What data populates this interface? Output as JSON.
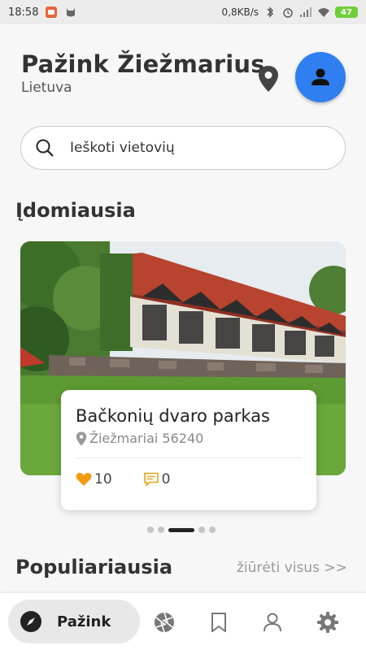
{
  "status_bar": {
    "time": "18:58",
    "speed": "0,8KB/s",
    "battery": "47"
  },
  "header": {
    "title": "Pažink Žiežmarius",
    "subtitle": "Lietuva"
  },
  "search": {
    "placeholder": "Ieškoti vietovių"
  },
  "featured": {
    "section_title": "Įdomiausia",
    "place_name": "Bačkonių dvaro parkas",
    "address": "Žiežmariai 56240",
    "likes": "10",
    "comments": "0",
    "carousel_active_index": 2,
    "carousel_count": 5
  },
  "popular": {
    "section_title": "Populiariausia",
    "see_all": "žiūrėti visus >>"
  },
  "bottom_nav": {
    "active_label": "Pažink",
    "items": [
      "compass-icon",
      "camera-aperture-icon",
      "bookmark-icon",
      "person-icon",
      "settings-gear-icon"
    ]
  },
  "colors": {
    "accent_blue": "#2f7ff0",
    "heart_orange": "#f39c12",
    "comment_orange": "#e8a317",
    "battery_green": "#6fcf3b"
  }
}
